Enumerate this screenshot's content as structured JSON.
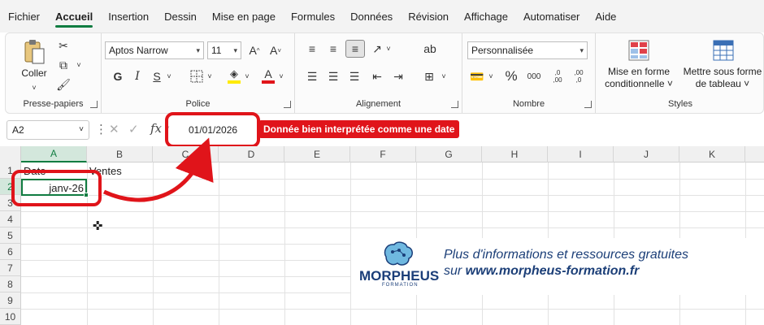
{
  "menu": {
    "tabs": [
      "Fichier",
      "Accueil",
      "Insertion",
      "Dessin",
      "Mise en page",
      "Formules",
      "Données",
      "Révision",
      "Affichage",
      "Automatiser",
      "Aide"
    ],
    "active": "Accueil"
  },
  "ribbon": {
    "clipboard": {
      "paste_label": "Coller",
      "group_label": "Presse-papiers"
    },
    "font": {
      "font_name": "Aptos Narrow",
      "font_size": "11",
      "group_label": "Police",
      "bold": "G",
      "italic": "I",
      "underline": "S",
      "grow": "A^",
      "shrink": "A˅"
    },
    "alignment": {
      "group_label": "Alignement"
    },
    "number": {
      "format": "Personnalisée",
      "group_label": "Nombre",
      "percent": "%",
      "thousands": "000",
      "dec_inc": ",0→,00",
      "dec_dec": ",00→,0"
    },
    "styles": {
      "group_label": "Styles",
      "conditional": [
        "Mise en forme",
        "conditionnelle ˅"
      ],
      "table": [
        "Mettre sous forme",
        "de tableau ˅"
      ]
    }
  },
  "formula_bar": {
    "name_box": "A2",
    "fx": "fx",
    "value": "01/01/2026"
  },
  "callout": "Donnée bien interprétée comme une date",
  "sheet": {
    "columns": [
      "A",
      "B",
      "C",
      "D",
      "E",
      "F",
      "G",
      "H",
      "I",
      "J",
      "K"
    ],
    "rows": [
      "1",
      "2",
      "3",
      "4",
      "5",
      "6",
      "7",
      "8",
      "9",
      "10"
    ],
    "cells": {
      "A1": "Date",
      "B1": "Ventes",
      "A2": "janv-26"
    },
    "selected_cell": "A2"
  },
  "promo": {
    "logo": "MORPHEUS",
    "logo_sub": "FORMATION",
    "line1": "Plus d'informations et ressources gratuites",
    "line2_prefix": "sur ",
    "line2_url": "www.morpheus-formation.fr"
  },
  "colors": {
    "excel_green": "#107c41",
    "highlight_red": "#e0141a",
    "brand_navy": "#1b3e79"
  }
}
